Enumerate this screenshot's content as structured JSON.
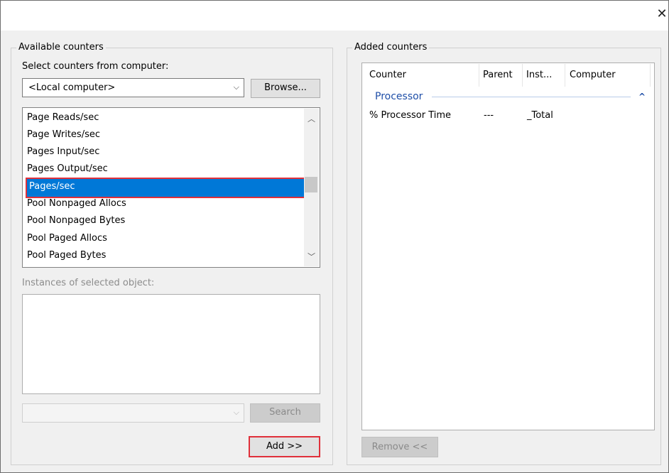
{
  "dialog": {
    "close_glyph": "✕"
  },
  "available": {
    "group_label": "Available counters",
    "computer_label": "Select counters from computer:",
    "computer_value": "<Local computer>",
    "browse_label": "Browse...",
    "counters": [
      "Page Reads/sec",
      "Page Writes/sec",
      "Pages Input/sec",
      "Pages Output/sec",
      "Pages/sec",
      "Pool Nonpaged Allocs",
      "Pool Nonpaged Bytes",
      "Pool Paged Allocs",
      "Pool Paged Bytes"
    ],
    "selected_counter": "Pages/sec",
    "instances_label": "Instances of selected object:",
    "search_value": "",
    "search_label": "Search",
    "add_label": "Add >>",
    "scroll_up_icon": "chevron-up-icon",
    "scroll_down_icon": "chevron-down-icon"
  },
  "added": {
    "group_label": "Added counters",
    "columns": [
      "Counter",
      "Parent",
      "Inst...",
      "Computer"
    ],
    "group_name": "Processor",
    "rows": [
      {
        "counter": "% Processor Time",
        "parent": "---",
        "instance": "_Total",
        "computer": ""
      }
    ],
    "remove_label": "Remove <<"
  },
  "colors": {
    "selection": "#0078d7",
    "highlight_border": "#e0303a",
    "group_header": "#1f4fa8"
  }
}
